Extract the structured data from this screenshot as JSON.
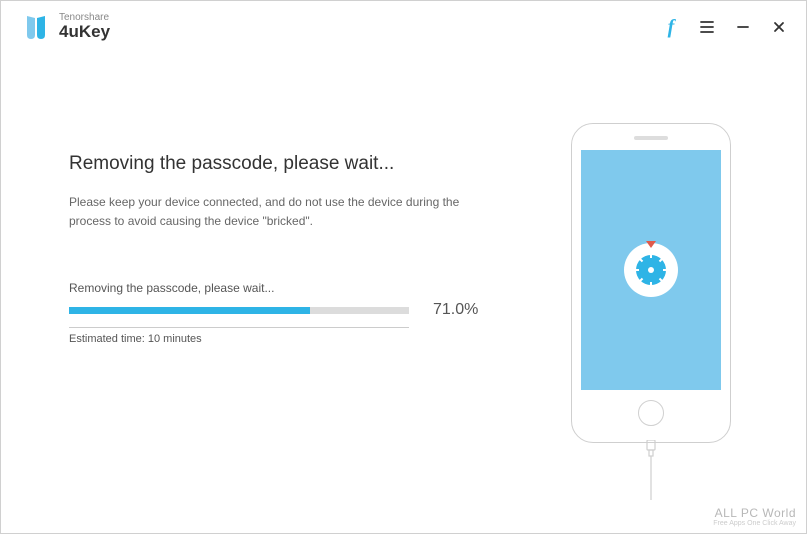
{
  "brand": {
    "company": "Tenorshare",
    "product": "4uKey"
  },
  "main": {
    "heading": "Removing the passcode, please wait...",
    "subtext": "Please keep your device connected, and do not use the device during the process to avoid causing the device \"bricked\".",
    "progress_label": "Removing the passcode, please wait...",
    "progress_percent_text": "71.0%",
    "progress_percent_value": 71,
    "estimated_label": "Estimated time: 10 minutes"
  },
  "watermark": {
    "line1": "ALL PC World",
    "line2": "Free Apps One Click Away"
  },
  "colors": {
    "accent": "#2eb4e6",
    "phone_screen": "#7fc9ed"
  }
}
